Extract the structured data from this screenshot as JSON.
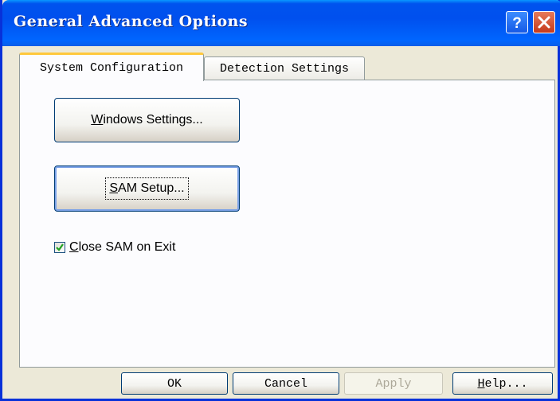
{
  "window": {
    "title": "General Advanced Options",
    "help_icon": "help-question-icon",
    "close_icon": "close-x-icon"
  },
  "tabs": [
    {
      "label": "System Configuration",
      "active": true
    },
    {
      "label": "Detection Settings",
      "active": false
    }
  ],
  "panel": {
    "windows_settings_button": {
      "accel": "W",
      "rest": "indows Settings..."
    },
    "sam_setup_button": {
      "accel": "S",
      "rest": "AM Setup..."
    },
    "close_checkbox": {
      "accel": "C",
      "rest": "lose SAM on Exit",
      "checked": true
    }
  },
  "footer": {
    "ok_label": "OK",
    "cancel_label": "Cancel",
    "apply_label": "Apply",
    "help_button": {
      "accel": "H",
      "rest": "elp..."
    }
  },
  "colors": {
    "title_blue": "#0053ee",
    "close_red": "#c5391b",
    "face": "#ece9d8",
    "tab_accent": "#ffc83c",
    "check_green": "#21a121"
  }
}
